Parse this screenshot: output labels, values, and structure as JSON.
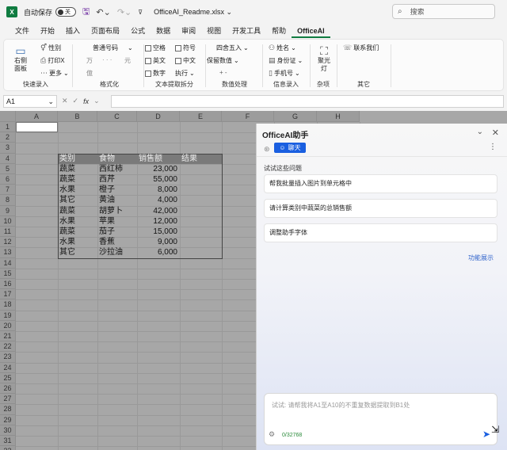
{
  "titlebar": {
    "app_icon": "X",
    "autosave_label": "自动保存",
    "autosave_state": "关",
    "filename": "OfficeAI_Readme.xlsx",
    "search_placeholder": "搜索"
  },
  "tabs": [
    "文件",
    "开始",
    "插入",
    "页面布局",
    "公式",
    "数据",
    "审阅",
    "视图",
    "开发工具",
    "帮助",
    "OfficeAI"
  ],
  "active_tab": "OfficeAI",
  "ribbon": {
    "quick": {
      "big_label": "右侧\n面板",
      "gender": "性别",
      "printx": "打印X",
      "more": "更多",
      "group": "快速录入"
    },
    "format": {
      "font_select": "普通号码",
      "yuan1": "万",
      "yuan2": "元",
      "yuan3": "億",
      "group": "格式化"
    },
    "text": {
      "c1": "空格",
      "c2": "英文",
      "c3": "数字",
      "c4": "符号",
      "c5": "中文",
      "c6": "执行",
      "group": "文本提取拆分"
    },
    "number": {
      "round": "四舍五入",
      "keep": "保留数值",
      "plusminus": "+ -",
      "group": "数值处理"
    },
    "info": {
      "name": "姓名",
      "id": "身份证",
      "phone": "手机号",
      "group": "信息录入"
    },
    "misc": {
      "big_label": "聚光\n灯",
      "group": "杂项"
    },
    "other": {
      "contact": "联系我们",
      "group": "其它"
    }
  },
  "formula_bar": {
    "cell_ref": "A1",
    "fx": "fx",
    "value": ""
  },
  "columns": [
    "A",
    "B",
    "C",
    "D",
    "E",
    "F",
    "G",
    "H"
  ],
  "rows": [
    "1",
    "2",
    "3",
    "4",
    "5",
    "6",
    "7",
    "8",
    "9",
    "10",
    "11",
    "12",
    "13",
    "14",
    "15",
    "16",
    "17",
    "18",
    "19",
    "20",
    "21",
    "22",
    "23",
    "24",
    "25",
    "26",
    "27",
    "28",
    "29",
    "30",
    "31",
    "32"
  ],
  "table": {
    "headers": [
      "类别",
      "食物",
      "销售额",
      "结果"
    ],
    "rows": [
      [
        "蔬菜",
        "西红柿",
        "23,000"
      ],
      [
        "蔬菜",
        "西芹",
        "55,000"
      ],
      [
        "水果",
        "橙子",
        "8,000"
      ],
      [
        "其它",
        "黄油",
        "4,000"
      ],
      [
        "蔬菜",
        "胡萝卜",
        "42,000"
      ],
      [
        "水果",
        "苹果",
        "12,000"
      ],
      [
        "蔬菜",
        "茄子",
        "15,000"
      ],
      [
        "水果",
        "香蕉",
        "9,000"
      ],
      [
        "其它",
        "沙拉油",
        "6,000"
      ]
    ]
  },
  "panel": {
    "title": "OfficeAI助手",
    "chat_label": "聊天",
    "hint_title": "试试这些问题",
    "suggestions": [
      "帮我批量插入图片到单元格中",
      "请计算类别中蔬菜的总销售额",
      "调整助手字体"
    ],
    "func_link": "功能展示",
    "input_placeholder": "试试: 请帮我将A1至A10的不重复数据提取到B1处",
    "counter": "0/32768"
  }
}
